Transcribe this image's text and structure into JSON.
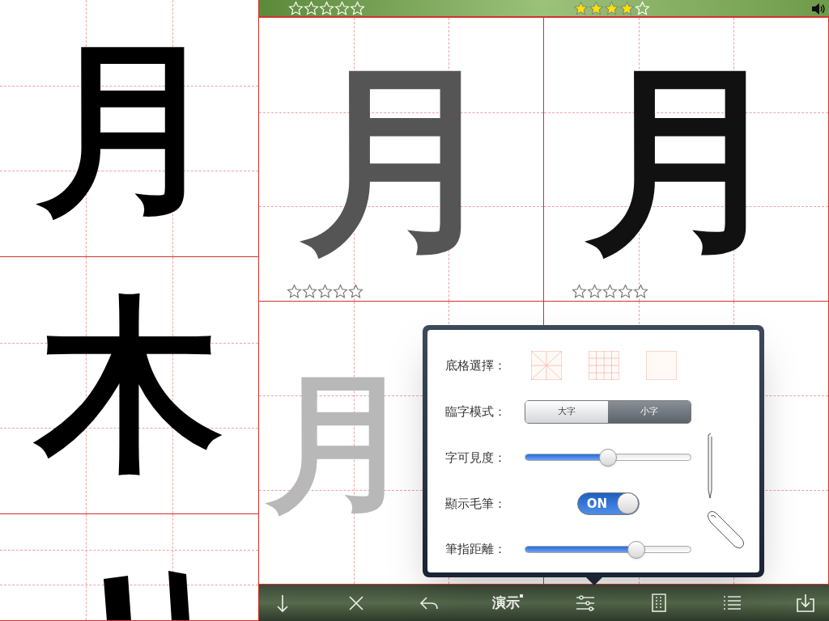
{
  "left_column": [
    {
      "kind": "character",
      "character": "月"
    },
    {
      "kind": "character",
      "character": "木"
    },
    {
      "kind": "cut"
    }
  ],
  "top_bar": {
    "ratings": [
      {
        "stars": 0
      },
      {
        "stars": 4
      }
    ]
  },
  "practice_cells": [
    {
      "kind": "template",
      "character": "月",
      "stars": 0
    },
    {
      "kind": "written",
      "character": "月",
      "stars": 0
    },
    {
      "kind": "faded",
      "character": "月"
    }
  ],
  "settings_popover": {
    "rows": [
      {
        "kind": "grid_choice",
        "label": "底格選擇：",
        "options": [
          {
            "kind": "rice"
          },
          {
            "kind": "nine"
          },
          {
            "kind": "plain"
          }
        ]
      },
      {
        "kind": "segmented",
        "label": "臨字模式：",
        "segments": [
          {
            "label": "大字",
            "selected": false
          },
          {
            "label": "小字",
            "selected": true
          }
        ]
      },
      {
        "kind": "slider",
        "label": "字可見度：",
        "level": 0.5
      },
      {
        "kind": "toggle",
        "label": "顯示毛筆：",
        "on": true,
        "on_label": "ON"
      },
      {
        "kind": "slider",
        "label": "筆指距離：",
        "level": 0.67
      }
    ]
  },
  "toolbar": {
    "demo_label": "演示"
  }
}
